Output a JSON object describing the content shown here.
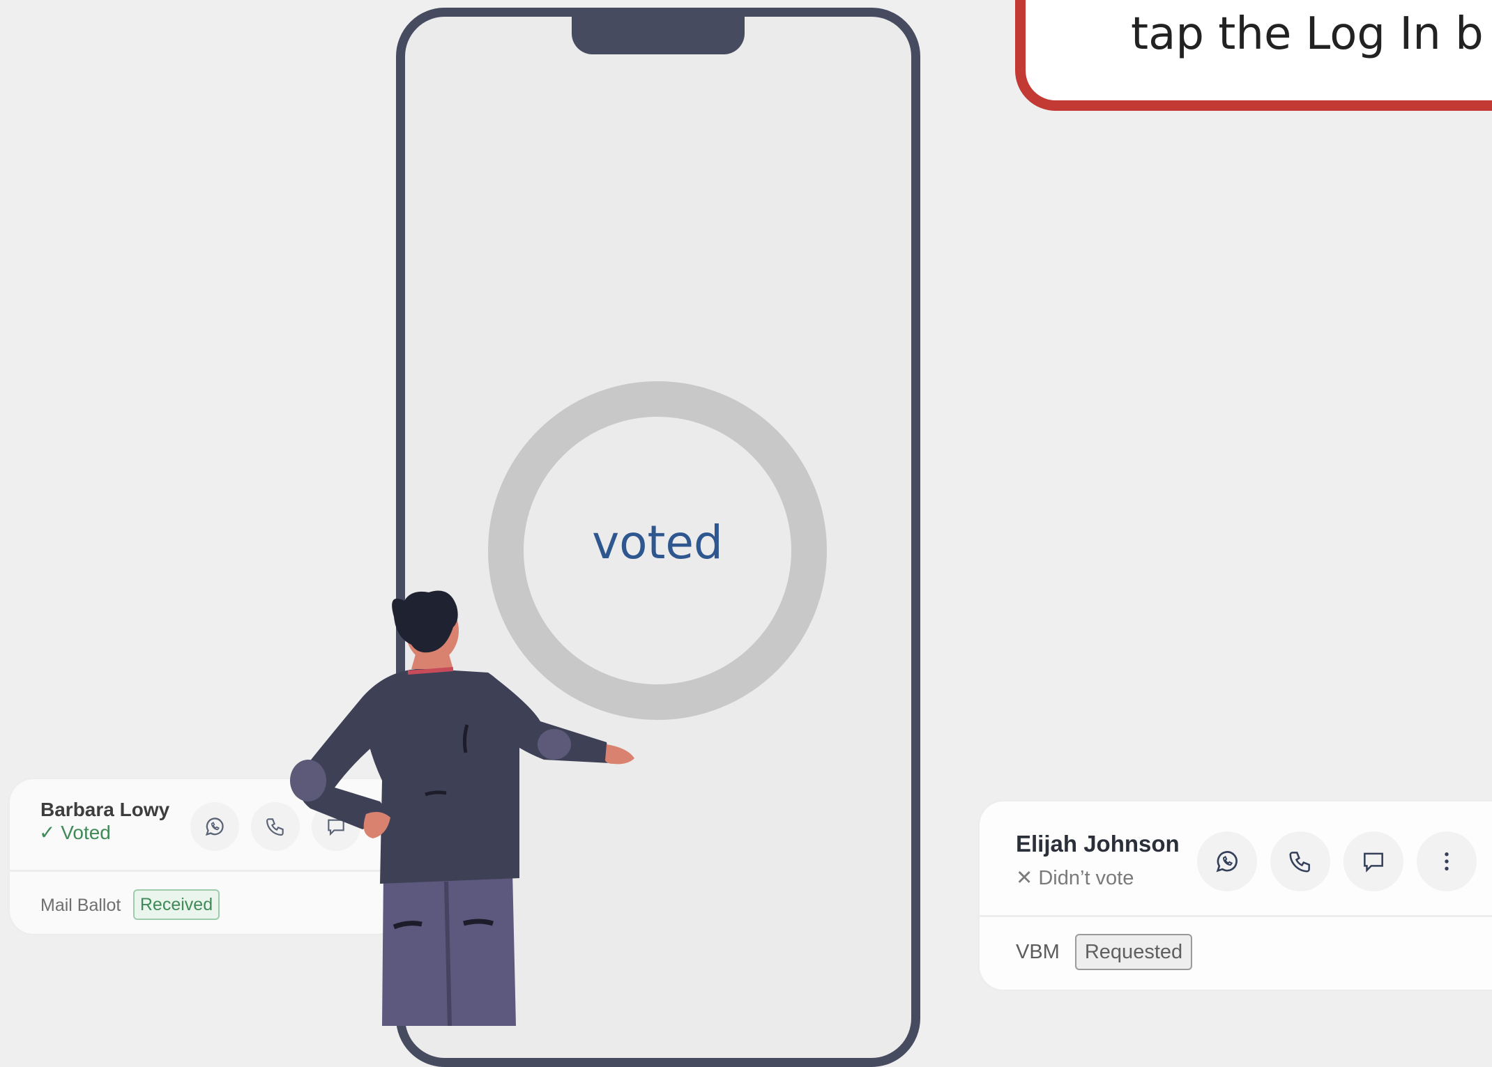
{
  "banner": {
    "text": "tap the Log In b"
  },
  "screen": {
    "status_word": "voted"
  },
  "card_left": {
    "name": "Barbara Lowy",
    "status_icon": "check-icon",
    "status": "✓ Voted",
    "status_color": "#3f8a57",
    "ballot_label": "Mail Ballot",
    "ballot_badge": "Received",
    "badge_color": "#3f8a57",
    "actions": [
      "whatsapp-icon",
      "phone-icon",
      "message-icon"
    ]
  },
  "card_right": {
    "name": "Elijah Johnson",
    "status_icon": "x-icon",
    "status": "✕ Didn’t vote",
    "status_color": "#7a7a7a",
    "ballot_label": "VBM",
    "ballot_badge": "Requested",
    "actions": [
      "whatsapp-icon",
      "phone-icon",
      "message-icon",
      "more-vertical-icon"
    ]
  },
  "colors": {
    "phone_frame": "#464b5f",
    "banner_border": "#c23a33",
    "ring": "#c8c8c8",
    "accent_text": "#2e568f"
  }
}
